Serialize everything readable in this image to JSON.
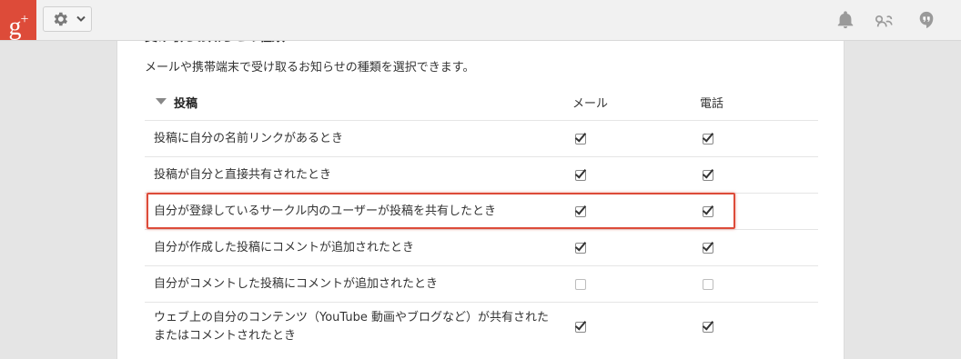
{
  "topbar": {
    "logo_text": "g+",
    "icons": [
      "gear-icon",
      "chevron-down-icon",
      "bell-icon",
      "share-icon",
      "hangouts-icon"
    ]
  },
  "panel": {
    "section_title": "受け取るお知らせの種類",
    "description": "メールや携帯端末で受け取るお知らせの種類を選択できます。",
    "group_label": "投稿",
    "columns": {
      "email": "メール",
      "phone": "電話"
    },
    "rows": [
      {
        "label": "投稿に自分の名前リンクがあるとき",
        "email": true,
        "phone": true
      },
      {
        "label": "投稿が自分と直接共有されたとき",
        "email": true,
        "phone": true
      },
      {
        "label": "自分が登録しているサークル内のユーザーが投稿を共有したとき",
        "email": true,
        "phone": true,
        "highlighted": true
      },
      {
        "label": "自分が作成した投稿にコメントが追加されたとき",
        "email": true,
        "phone": true
      },
      {
        "label": "自分がコメントした投稿にコメントが追加されたとき",
        "email": false,
        "phone": false
      },
      {
        "label": "ウェブ上の自分のコンテンツ（YouTube 動画やブログなど）が共有されたまたはコメントされたとき",
        "email": true,
        "phone": true
      }
    ]
  },
  "colors": {
    "brand_red": "#dd4b39",
    "highlight_border": "#dd4b39"
  }
}
